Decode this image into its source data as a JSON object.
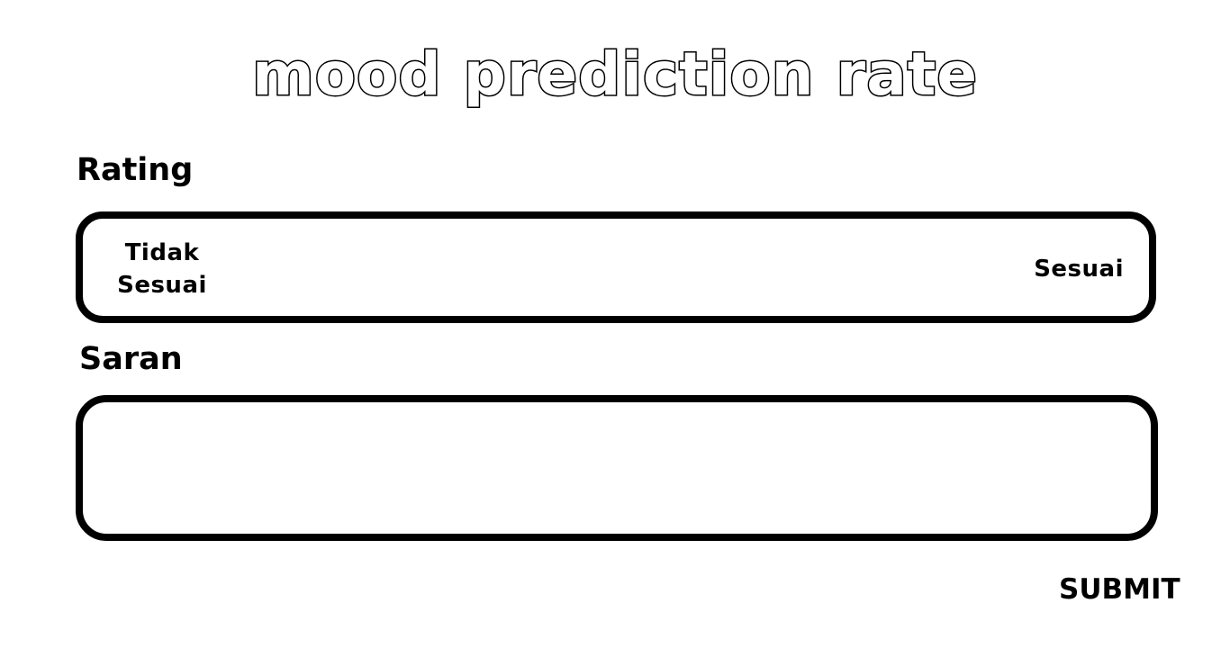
{
  "header": {
    "title": "mood prediction rate"
  },
  "rating": {
    "label": "Rating",
    "scale_low_label_line1": "Tidak",
    "scale_low_label_line2": "Sesuai",
    "scale_high_label": "Sesuai"
  },
  "saran": {
    "label": "Saran",
    "value": ""
  },
  "actions": {
    "submit_label": "SUBMIT"
  },
  "colors": {
    "background": "#ffffff",
    "stroke": "#000000"
  }
}
